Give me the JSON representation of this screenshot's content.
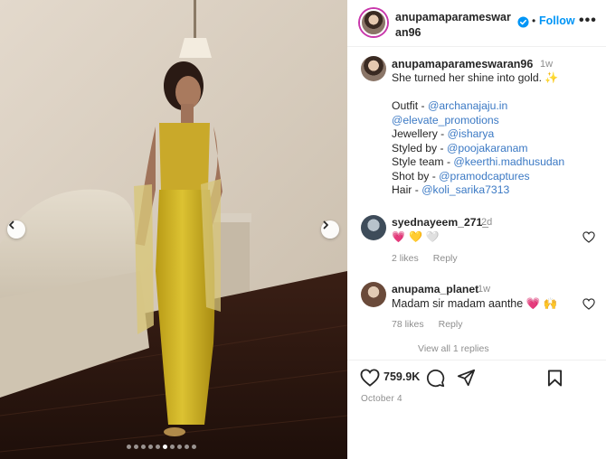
{
  "post": {
    "username": "anupamaparameswaran96",
    "follow_label": "Follow",
    "separator": "•",
    "more_label": "•••",
    "likes": "759.9K",
    "date": "October 4",
    "carousel": {
      "total_slides": 10,
      "active_slide": 6
    }
  },
  "caption": {
    "username": "anupamaparameswaran96",
    "time": "1w",
    "first_line": "She turned her shine into gold. ✨",
    "credits": [
      {
        "label": "Outfit - ",
        "handle": "@archanajaju.in"
      },
      {
        "label": "",
        "handle": "@elevate_promotions"
      },
      {
        "label": "Jewellery - ",
        "handle": "@isharya"
      },
      {
        "label": "Styled by - ",
        "handle": "@poojakaranam"
      },
      {
        "label": "Style team - ",
        "handle": "@keerthi.madhusudan"
      },
      {
        "label": "Shot by - ",
        "handle": "@pramodcaptures"
      },
      {
        "label": "Hair - ",
        "handle": "@koli_sarika7313"
      }
    ]
  },
  "comments": [
    {
      "username": "syednayeem_271_",
      "time": "2d",
      "emojis": [
        "💗",
        "💛",
        "🤍"
      ],
      "likes": "2 likes",
      "reply_label": "Reply"
    },
    {
      "username": "anupama_planet",
      "time": "1w",
      "text": "Madam sir madam aanthe 💗 🙌",
      "likes": "78 likes",
      "reply_label": "Reply"
    }
  ],
  "view_replies": "View all 1 replies",
  "colors": {
    "link": "#3b79c4",
    "follow": "#0095f6",
    "verified": "#0095f6",
    "dress": "#d1b426"
  }
}
